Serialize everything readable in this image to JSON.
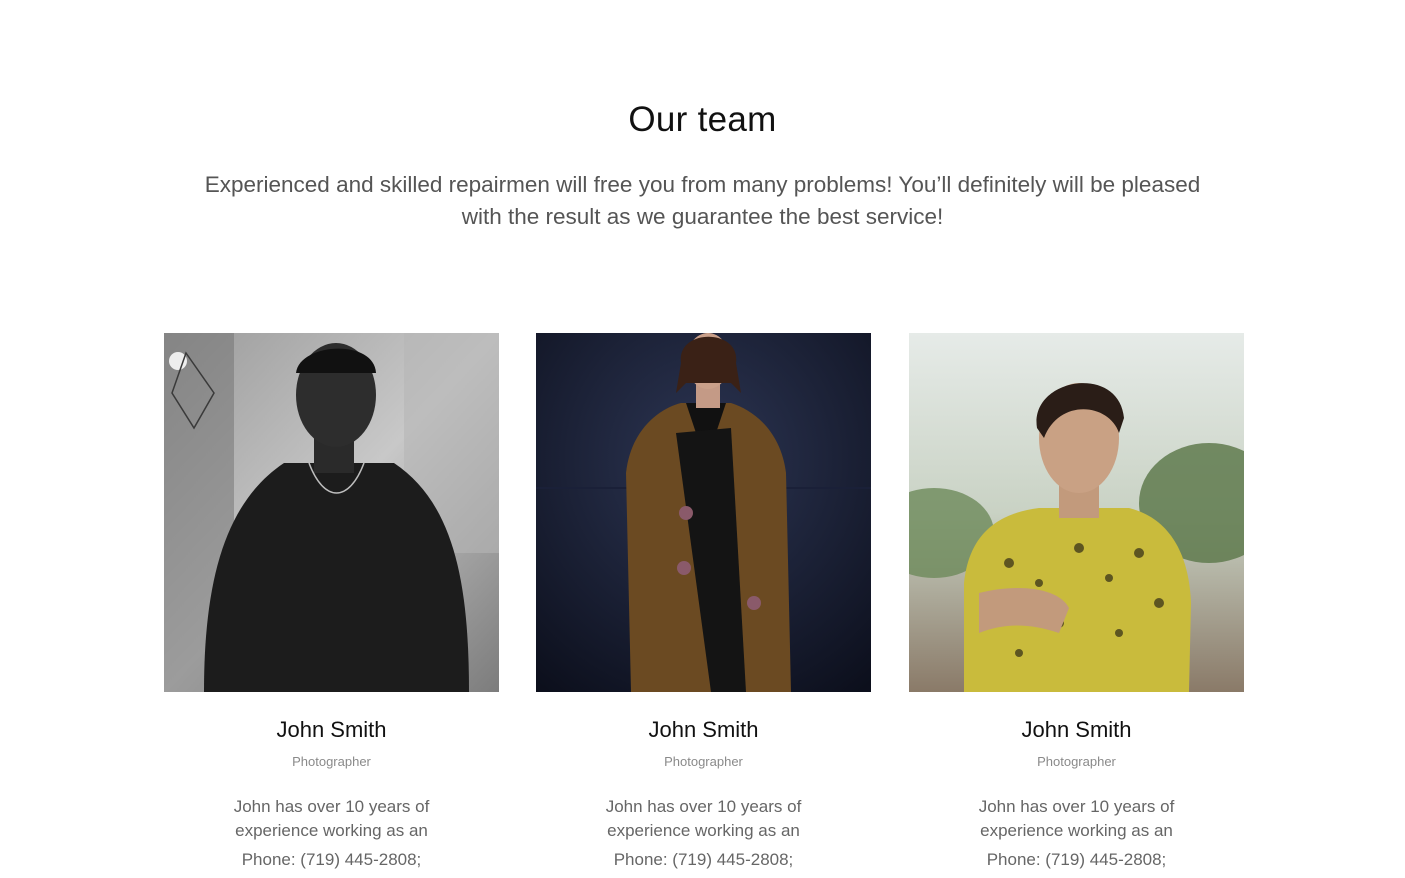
{
  "team_section": {
    "title": "Our team",
    "subtitle": "Experienced and skilled repairmen will free you from many problems! You’ll definitely will be pleased with the result as we guarantee the best service!"
  },
  "members": [
    {
      "name": "John Smith",
      "role": "Photographer",
      "bio": "John has over 10 years of experience working as an",
      "phone": "Phone: (719) 445-2808;"
    },
    {
      "name": "John Smith",
      "role": "Photographer",
      "bio": "John has over 10 years of experience working as an",
      "phone": "Phone: (719) 445-2808;"
    },
    {
      "name": "John Smith",
      "role": "Photographer",
      "bio": "John has over 10 years of experience working as an",
      "phone": "Phone: (719) 445-2808;"
    }
  ],
  "colors": {
    "title": "#111111",
    "subtitle": "#555555",
    "role": "#8a8a8a",
    "body_text": "#666666",
    "background": "#ffffff"
  }
}
